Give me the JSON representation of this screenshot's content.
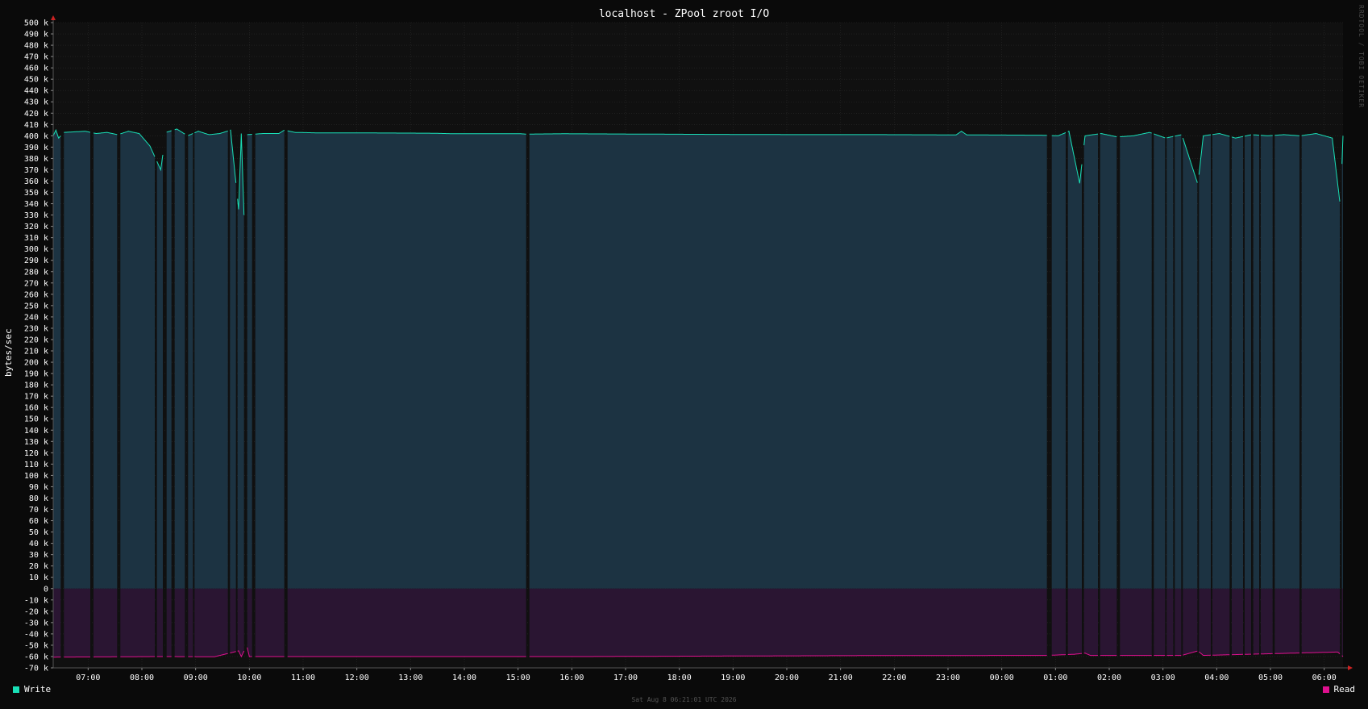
{
  "colors": {
    "background": "#0a0a0a",
    "plot_background": "#101010",
    "write_line": "#19e0b7",
    "write_fill": "#1c3342",
    "read_line": "#e0108f",
    "read_fill": "#2a1532",
    "grid": "#2a2a2a",
    "axis_arrow": "#cc2222"
  },
  "legend": {
    "write_label": "Write",
    "read_label": "Read"
  },
  "footer": {
    "timestamp": "Sat Aug  8 06:21:01 UTC 2026"
  },
  "watermark": "RRDTOOL / TOBI OETIKER",
  "chart_data": {
    "type": "area",
    "title": "localhost - ZPool zroot I/O",
    "ylabel": "bytes/sec",
    "xlabel": "",
    "ylim": [
      -70000,
      500000
    ],
    "y_tick_step": 10000,
    "y_ticks": [
      "500 k",
      "490 k",
      "480 k",
      "470 k",
      "460 k",
      "450 k",
      "440 k",
      "430 k",
      "420 k",
      "410 k",
      "400 k",
      "390 k",
      "380 k",
      "370 k",
      "360 k",
      "350 k",
      "340 k",
      "330 k",
      "320 k",
      "310 k",
      "300 k",
      "290 k",
      "280 k",
      "270 k",
      "260 k",
      "250 k",
      "240 k",
      "230 k",
      "220 k",
      "210 k",
      "200 k",
      "190 k",
      "180 k",
      "170 k",
      "160 k",
      "150 k",
      "140 k",
      "130 k",
      "120 k",
      "110 k",
      "100 k",
      "90 k",
      "80 k",
      "70 k",
      "60 k",
      "50 k",
      "40 k",
      "30 k",
      "20 k",
      "10 k",
      "0",
      "-10 k",
      "-20 k",
      "-30 k",
      "-40 k",
      "-50 k",
      "-60 k",
      "-70 k"
    ],
    "x_ticks": [
      "07:00",
      "08:00",
      "09:00",
      "10:00",
      "11:00",
      "12:00",
      "13:00",
      "14:00",
      "15:00",
      "16:00",
      "17:00",
      "18:00",
      "19:00",
      "20:00",
      "21:00",
      "22:00",
      "23:00",
      "00:00",
      "01:00",
      "02:00",
      "03:00",
      "04:00",
      "05:00",
      "06:00"
    ],
    "x_range_hours": [
      0,
      24
    ],
    "x_first_tick_offset_hours": 0.65,
    "grid": true,
    "legend_placement": "bottom",
    "series": [
      {
        "name": "Write",
        "baseline": 402000,
        "points": [
          [
            0.0,
            400000
          ],
          [
            0.05,
            405000
          ],
          [
            0.1,
            398000
          ],
          [
            0.2,
            403000
          ],
          [
            0.4,
            403500
          ],
          [
            0.6,
            404000
          ],
          [
            0.8,
            402000
          ],
          [
            1.0,
            403000
          ],
          [
            1.2,
            401000
          ],
          [
            1.4,
            404000
          ],
          [
            1.6,
            402000
          ],
          [
            1.8,
            391000
          ],
          [
            2.0,
            370000
          ],
          [
            2.1,
            403000
          ],
          [
            2.3,
            406000
          ],
          [
            2.5,
            400000
          ],
          [
            2.7,
            404000
          ],
          [
            2.9,
            401000
          ],
          [
            3.1,
            402000
          ],
          [
            3.3,
            405000
          ],
          [
            3.45,
            335000
          ],
          [
            3.5,
            402000
          ],
          [
            3.55,
            330000
          ],
          [
            3.6,
            401000
          ],
          [
            3.9,
            402000
          ],
          [
            4.2,
            402000
          ],
          [
            4.3,
            405000
          ],
          [
            4.5,
            403000
          ],
          [
            5.0,
            402500
          ],
          [
            6.0,
            402500
          ],
          [
            7.0,
            402300
          ],
          [
            7.5,
            401800
          ],
          [
            8.7,
            401800
          ],
          [
            8.8,
            401500
          ],
          [
            9.5,
            401800
          ],
          [
            11.0,
            401500
          ],
          [
            12.0,
            401300
          ],
          [
            14.0,
            401000
          ],
          [
            15.5,
            401000
          ],
          [
            16.8,
            400800
          ],
          [
            16.9,
            404000
          ],
          [
            17.0,
            400800
          ],
          [
            18.4,
            400500
          ],
          [
            18.7,
            400000
          ],
          [
            18.9,
            404000
          ],
          [
            19.1,
            358000
          ],
          [
            19.2,
            400000
          ],
          [
            19.5,
            402000
          ],
          [
            19.8,
            399000
          ],
          [
            20.1,
            400000
          ],
          [
            20.4,
            403000
          ],
          [
            20.7,
            398000
          ],
          [
            21.0,
            401000
          ],
          [
            21.3,
            357000
          ],
          [
            21.4,
            400000
          ],
          [
            21.7,
            402000
          ],
          [
            22.0,
            398000
          ],
          [
            22.3,
            401000
          ],
          [
            22.6,
            400000
          ],
          [
            22.9,
            401000
          ],
          [
            23.2,
            400000
          ],
          [
            23.5,
            402000
          ],
          [
            23.8,
            398000
          ],
          [
            23.95,
            338000
          ],
          [
            24.0,
            400000
          ]
        ],
        "gaps_hours": [
          [
            0.15,
            0.2
          ],
          [
            0.7,
            0.75
          ],
          [
            1.2,
            1.25
          ],
          [
            1.9,
            1.93
          ],
          [
            2.05,
            2.1
          ],
          [
            2.2,
            2.25
          ],
          [
            2.45,
            2.5
          ],
          [
            2.6,
            2.62
          ],
          [
            3.25,
            3.28
          ],
          [
            3.4,
            3.42
          ],
          [
            3.55,
            3.6
          ],
          [
            3.7,
            3.75
          ],
          [
            4.3,
            4.35
          ],
          [
            8.8,
            8.85
          ],
          [
            18.5,
            18.58
          ],
          [
            18.85,
            18.88
          ],
          [
            19.15,
            19.18
          ],
          [
            19.45,
            19.48
          ],
          [
            19.8,
            19.85
          ],
          [
            20.45,
            20.48
          ],
          [
            20.7,
            20.72
          ],
          [
            20.85,
            20.87
          ],
          [
            21.0,
            21.02
          ],
          [
            21.3,
            21.32
          ],
          [
            21.55,
            21.57
          ],
          [
            21.9,
            21.93
          ],
          [
            22.15,
            22.17
          ],
          [
            22.3,
            22.33
          ],
          [
            22.45,
            22.47
          ],
          [
            22.7,
            22.73
          ],
          [
            23.2,
            23.23
          ],
          [
            23.95,
            23.98
          ]
        ]
      },
      {
        "name": "Read",
        "baseline": -60000,
        "points": [
          [
            0.0,
            -60500
          ],
          [
            1.0,
            -60300
          ],
          [
            2.0,
            -60000
          ],
          [
            3.0,
            -60200
          ],
          [
            3.45,
            -55000
          ],
          [
            3.5,
            -60000
          ],
          [
            3.6,
            -50000
          ],
          [
            3.65,
            -60000
          ],
          [
            5.0,
            -60000
          ],
          [
            10.0,
            -60000
          ],
          [
            12.8,
            -59500
          ],
          [
            15.0,
            -59200
          ],
          [
            18.5,
            -59000
          ],
          [
            19.0,
            -58000
          ],
          [
            19.2,
            -57000
          ],
          [
            19.3,
            -59000
          ],
          [
            21.0,
            -59000
          ],
          [
            21.3,
            -55000
          ],
          [
            21.4,
            -59000
          ],
          [
            23.9,
            -56000
          ],
          [
            24.0,
            -60000
          ]
        ]
      }
    ]
  }
}
